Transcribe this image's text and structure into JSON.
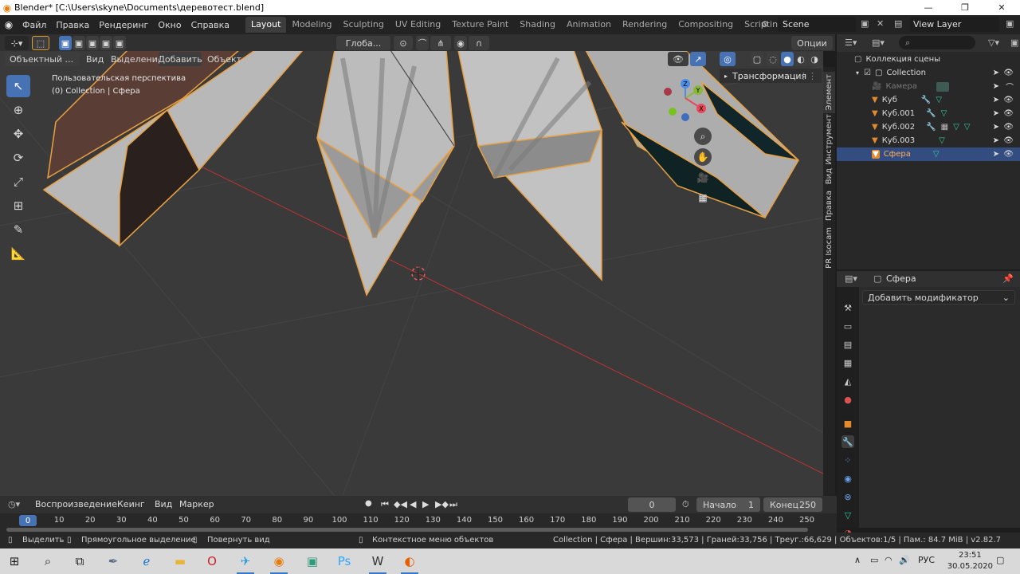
{
  "window": {
    "title": "Blender* [C:\\Users\\skyne\\Documents\\деревотест.blend]",
    "minimize": "—",
    "maximize": "❐",
    "close": "✕"
  },
  "menu": {
    "items": [
      "Файл",
      "Правка",
      "Рендеринг",
      "Окно",
      "Справка"
    ]
  },
  "workspaces": {
    "tabs": [
      "Layout",
      "Modeling",
      "Sculpting",
      "UV Editing",
      "Texture Paint",
      "Shading",
      "Animation",
      "Rendering",
      "Compositing",
      "Scripting"
    ],
    "active": "Layout",
    "add": "+"
  },
  "scene": {
    "name": "Scene",
    "view_layer": "View Layer"
  },
  "viewport": {
    "transform_orientation": "Глоба...",
    "options": "Опции",
    "mode": "Объектный ...",
    "menus": [
      "Вид",
      "Выделение",
      "Добавить",
      "Объект"
    ],
    "perspective_label": "Пользовательская перспектива",
    "object_label": "(0) Collection | Сфера",
    "npanel_tabs": [
      "Элемент",
      "Инструмент",
      "Вид",
      "Правка",
      "PR Isocam"
    ],
    "transform_panel": "Трансформация",
    "gizmo_axes": {
      "x": "X",
      "y": "Y",
      "z": "Z"
    }
  },
  "outliner": {
    "search_placeholder": "⌕",
    "root": "Коллекция сцены",
    "collection": "Collection",
    "items": [
      {
        "name": "Камера",
        "dim": true
      },
      {
        "name": "Куб",
        "dim": false
      },
      {
        "name": "Куб.001",
        "dim": false
      },
      {
        "name": "Куб.002",
        "dim": false
      },
      {
        "name": "Куб.003",
        "dim": false
      },
      {
        "name": "Сфера",
        "dim": false,
        "selected": true
      }
    ]
  },
  "properties": {
    "object_name": "Сфера",
    "add_modifier": "Добавить модификатор"
  },
  "timeline": {
    "menus": [
      "Воспроизведение",
      "Кеинг",
      "Вид",
      "Маркер"
    ],
    "current_frame": "0",
    "start_label": "Начало",
    "start_value": "1",
    "end_label": "Конец",
    "end_value": "250",
    "ticks": [
      "0",
      "10",
      "20",
      "30",
      "40",
      "50",
      "60",
      "70",
      "80",
      "90",
      "100",
      "110",
      "120",
      "130",
      "140",
      "150",
      "160",
      "170",
      "180",
      "190",
      "200",
      "210",
      "220",
      "230",
      "240",
      "250"
    ]
  },
  "status": {
    "select": "Выделить",
    "box_select": "Прямоугольное выделение",
    "rotate_view": "Повернуть вид",
    "context_menu": "Контекстное меню объектов",
    "stats": "Collection | Сфера | Вершин:33,573 | Граней:33,756 | Треуг.:66,629 | Объектов:1/5 | Пам.: 84.7 MiB | v2.82.7"
  },
  "taskbar": {
    "lang": "РУС",
    "time": "23:51",
    "date": "30.05.2020"
  }
}
